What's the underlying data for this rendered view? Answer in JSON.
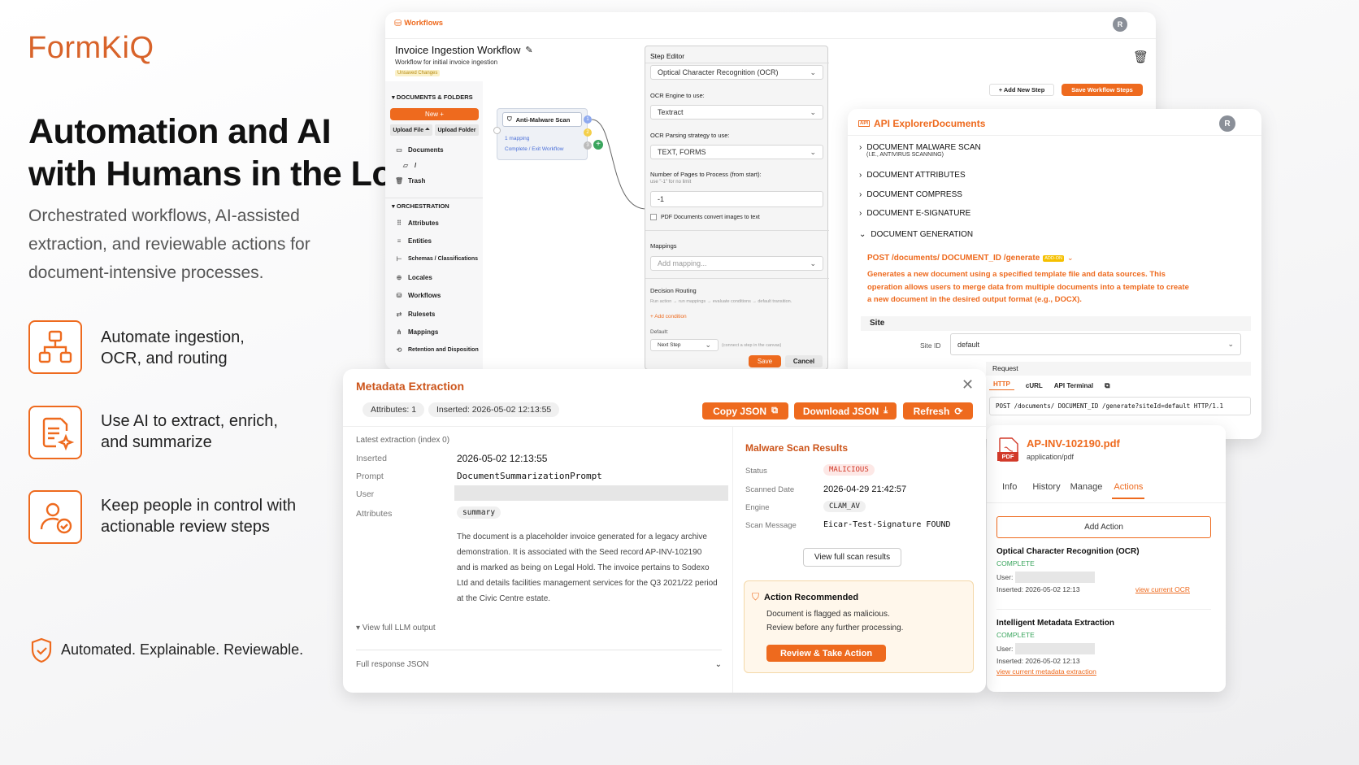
{
  "brand": {
    "logo": "FormKiQ"
  },
  "hero": {
    "title_line1": "Automation and AI",
    "title_line2": "with Humans in the Loop",
    "subtitle_line1": "Orchestrated workflows, AI-assisted",
    "subtitle_line2": "extraction, and reviewable actions for",
    "subtitle_line3": "document-intensive processes."
  },
  "features": [
    {
      "icon": "workflow-icon",
      "line1": "Automate ingestion,",
      "line2": "OCR, and routing"
    },
    {
      "icon": "document-ai-icon",
      "line1": "Use AI to extract, enrich,",
      "line2": "and summarize"
    },
    {
      "icon": "user-check-icon",
      "line1": "Keep people in control with",
      "line2": "actionable review steps"
    }
  ],
  "tagline": "Automated. Explainable. Reviewable.",
  "workflows": {
    "app_label": "Workflows",
    "avatar": "R",
    "title": "Invoice Ingestion Workflow",
    "subtitle": "Workflow for initial invoice ingestion",
    "unsaved": "Unsaved Changes",
    "sidebar": {
      "docs_header": "DOCUMENTS & FOLDERS",
      "new_btn": "New +",
      "upload_file": "Upload File",
      "upload_folder": "Upload Folder",
      "doc_items": [
        {
          "icon": "documents-icon",
          "label": "Documents"
        },
        {
          "icon": "folder-icon",
          "label": "/"
        },
        {
          "icon": "trash-icon",
          "label": "Trash"
        }
      ],
      "orch_header": "ORCHESTRATION",
      "orch_items": [
        {
          "icon": "attributes-icon",
          "label": "Attributes"
        },
        {
          "icon": "entities-icon",
          "label": "Entities"
        },
        {
          "icon": "schemas-icon",
          "label": "Schemas / Classifications"
        },
        {
          "icon": "locales-icon",
          "label": "Locales"
        },
        {
          "icon": "workflows-icon",
          "label": "Workflows"
        },
        {
          "icon": "rulesets-icon",
          "label": "Rulesets"
        },
        {
          "icon": "mappings-icon",
          "label": "Mappings"
        },
        {
          "icon": "retention-icon",
          "label": "Retention and Disposition"
        }
      ]
    },
    "node": {
      "title": "Anti-Malware Scan",
      "mapping": "1 mapping",
      "exits": "Complete / Exit Workflow",
      "badges": [
        "1",
        "2",
        "3"
      ]
    },
    "add_step": "+ Add New Step",
    "save_steps": "Save Workflow Steps",
    "step_editor": {
      "title": "Step Editor",
      "step_type": "Optical Character Recognition (OCR)",
      "engine_label": "OCR Engine to use:",
      "engine": "Textract",
      "strategy_label": "OCR Parsing strategy to use:",
      "strategy": "TEXT, FORMS",
      "pages_label": "Number of Pages to Process (from start):",
      "pages_hint": "use \"-1\" for no limit",
      "pages_value": "-1",
      "pdf_checkbox": "PDF Documents convert images to text",
      "mappings_label": "Mappings",
      "mappings_placeholder": "Add mapping...",
      "routing_label": "Decision Routing",
      "routing_hint": "Run action → run mappings → evaluate conditions → default transition.",
      "add_condition": "+ Add condition",
      "default_label": "Default:",
      "default_value": "Next Step",
      "default_hint": "(connect a step in the canvas)",
      "save": "Save",
      "cancel": "Cancel"
    }
  },
  "api_explorer": {
    "title": "API ExplorerDocuments",
    "badge": "API",
    "avatar": "R",
    "sections": [
      {
        "label": "DOCUMENT MALWARE SCAN",
        "sub": "(I.E., ANTIVIRUS SCANNING)"
      },
      {
        "label": "DOCUMENT ATTRIBUTES",
        "sub": ""
      },
      {
        "label": "DOCUMENT COMPRESS",
        "sub": ""
      },
      {
        "label": "DOCUMENT E-SIGNATURE",
        "sub": ""
      }
    ],
    "open_section": "DOCUMENT GENERATION",
    "endpoint": "POST /documents/ DOCUMENT_ID /generate",
    "addon": "ADD-ON",
    "description": "Generates a new document using a specified template file and data sources. This operation allows users to merge data from multiple documents into a template to create a new document in the desired output format (e.g., DOCX).",
    "site_header": "Site",
    "site_label": "Site ID",
    "site_value": "default",
    "request_label": "Request",
    "tabs": [
      "HTTP",
      "cURL",
      "API Terminal"
    ],
    "request_line": "POST /documents/ DOCUMENT_ID /generate?siteId=default HTTP/1.1"
  },
  "metadata": {
    "title": "Metadata Extraction",
    "attr_pill": "Attributes: 1",
    "inserted_pill": "Inserted: 2026-05-02 12:13:55",
    "copy_json": "Copy JSON",
    "download_json": "Download JSON",
    "refresh": "Refresh",
    "latest": "Latest extraction (index 0)",
    "inserted_label": "Inserted",
    "inserted_value": "2026-05-02 12:13:55",
    "prompt_label": "Prompt",
    "prompt_value": "DocumentSummarizationPrompt",
    "user_label": "User",
    "attributes_label": "Attributes",
    "attribute_tag": "summary",
    "summary_lines": [
      "The document is a placeholder invoice generated for a legacy archive",
      "demonstration. It is associated with the Seed record AP-INV-102190",
      "and is marked as being on Legal Hold. The invoice pertains to Sodexo",
      "Ltd and details facilities management services for the Q3 2021/22 period",
      "at the Civic Centre estate."
    ],
    "view_llm": "▾ View full LLM output",
    "full_json": "Full response JSON",
    "malware": {
      "title": "Malware Scan Results",
      "status_label": "Status",
      "status_value": "MALICIOUS",
      "scanned_label": "Scanned Date",
      "scanned_value": "2026-04-29 21:42:57",
      "engine_label": "Engine",
      "engine_value": "CLAM_AV",
      "message_label": "Scan Message",
      "message_value": "Eicar-Test-Signature FOUND",
      "view_full": "View full scan results",
      "rec_title": "Action Recommended",
      "rec_line1": "Document is flagged as malicious.",
      "rec_line2": "Review before any further processing.",
      "review_btn": "Review & Take Action"
    }
  },
  "doc_panel": {
    "file": "AP-INV-102190.pdf",
    "mime": "application/pdf",
    "pdf_badge": "PDF",
    "tabs": [
      "Info",
      "History",
      "Manage",
      "Actions"
    ],
    "active_tab": "Actions",
    "add_action": "Add Action",
    "actions": [
      {
        "name": "Optical Character Recognition (OCR)",
        "status": "COMPLETE",
        "user_label": "User:",
        "inserted": "Inserted: 2026-05-02 12:13",
        "link": "view current OCR"
      },
      {
        "name": "Intelligent Metadata Extraction",
        "status": "COMPLETE",
        "user_label": "User:",
        "inserted": "Inserted: 2026-05-02 12:13",
        "link": "view current metadata extraction"
      }
    ]
  },
  "colors": {
    "accent": "#ee6a1e",
    "danger": "#d23a2a",
    "success": "#3aa55d"
  }
}
